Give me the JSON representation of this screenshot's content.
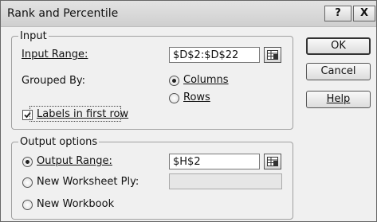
{
  "window": {
    "title": "Rank and Percentile",
    "help_glyph": "?",
    "close_glyph": "X"
  },
  "input_group": {
    "legend": "Input",
    "input_range_label": "Input Range:",
    "input_range_value": "$D$2:$D$22",
    "grouped_by_label": "Grouped By:",
    "columns_label": "Columns",
    "columns_selected": true,
    "rows_label": "Rows",
    "rows_selected": false,
    "labels_first_row_label": "Labels in first row",
    "labels_first_row_checked": true
  },
  "output_group": {
    "legend": "Output options",
    "output_range_label": "Output Range:",
    "output_range_value": "$H$2",
    "output_range_selected": true,
    "new_worksheet_label": "New Worksheet Ply:",
    "new_worksheet_value": "",
    "new_workbook_label": "New Workbook"
  },
  "buttons": {
    "ok": "OK",
    "cancel": "Cancel",
    "help": "Help"
  }
}
